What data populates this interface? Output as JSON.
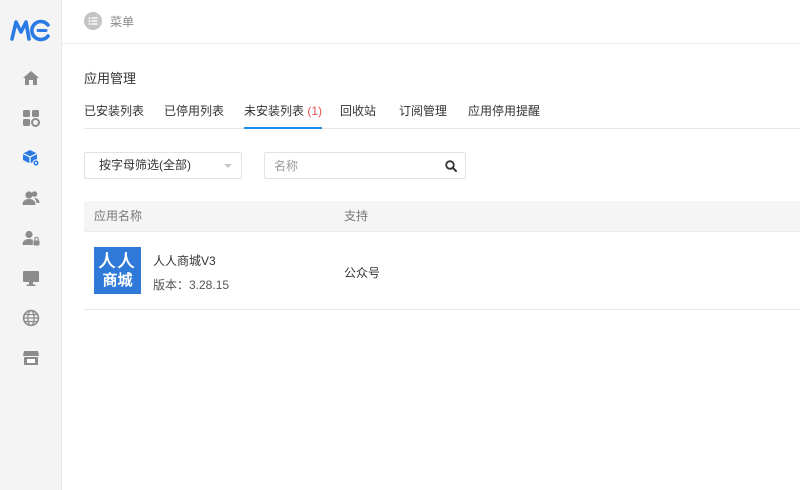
{
  "logo": {
    "text": "MC"
  },
  "sidebar": {
    "items": [
      {
        "icon": "home-icon"
      },
      {
        "icon": "apps-settings-icon"
      },
      {
        "icon": "app-package-icon",
        "active": true
      },
      {
        "icon": "users-icon"
      },
      {
        "icon": "user-lock-icon"
      },
      {
        "icon": "monitor-icon"
      },
      {
        "icon": "globe-icon"
      },
      {
        "icon": "store-icon"
      }
    ]
  },
  "topbar": {
    "menu_label": "菜单"
  },
  "page": {
    "title": "应用管理"
  },
  "tabs": [
    {
      "label": "已安装列表",
      "active": false
    },
    {
      "label": "已停用列表",
      "active": false
    },
    {
      "label": "未安装列表",
      "count": "(1)",
      "active": true
    },
    {
      "label": "回收站",
      "active": false
    },
    {
      "label": "订阅管理",
      "active": false
    },
    {
      "label": "应用停用提醒",
      "active": false
    }
  ],
  "filter": {
    "selected": "按字母筛选(全部)"
  },
  "search": {
    "placeholder": "名称",
    "value": ""
  },
  "table": {
    "headers": [
      "应用名称",
      "支持"
    ],
    "rows": [
      {
        "icon_text_line1": "人人",
        "icon_text_line2": "商城",
        "name": "人人商城V3",
        "version": "版本：3.28.15",
        "support": "公众号"
      }
    ]
  },
  "colors": {
    "accent": "#1d8cf0",
    "count": "#e45050",
    "app_icon_bg": "#2f7ad8",
    "logo": "#2c7be5"
  }
}
